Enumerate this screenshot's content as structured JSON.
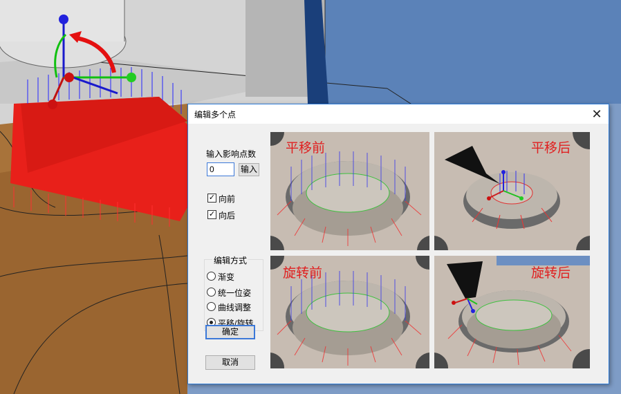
{
  "dialog": {
    "title": "编辑多个点",
    "close_glyph": "✕",
    "input_label": "输入影响点数",
    "input_value": "0",
    "input_button": "输入",
    "checkbox_forward": {
      "label": "向前",
      "checked": true
    },
    "checkbox_backward": {
      "label": "向后",
      "checked": true
    },
    "edit_mode": {
      "title": "编辑方式",
      "options": [
        {
          "label": "渐变",
          "selected": false
        },
        {
          "label": "统一位姿",
          "selected": false
        },
        {
          "label": "曲线调整",
          "selected": false
        },
        {
          "label": "平移/旋转",
          "selected": true
        }
      ]
    },
    "ok_button": "确定",
    "cancel_button": "取消",
    "images": [
      {
        "caption": "平移前"
      },
      {
        "caption": "平移后"
      },
      {
        "caption": "旋转前"
      },
      {
        "caption": "旋转后"
      }
    ]
  },
  "colors": {
    "accent": "#3b78d8",
    "caption_red": "#e02020",
    "viewport_blue": "#5b82b8",
    "surface_red": "#e8201a",
    "wood_brown": "#9a6530"
  }
}
